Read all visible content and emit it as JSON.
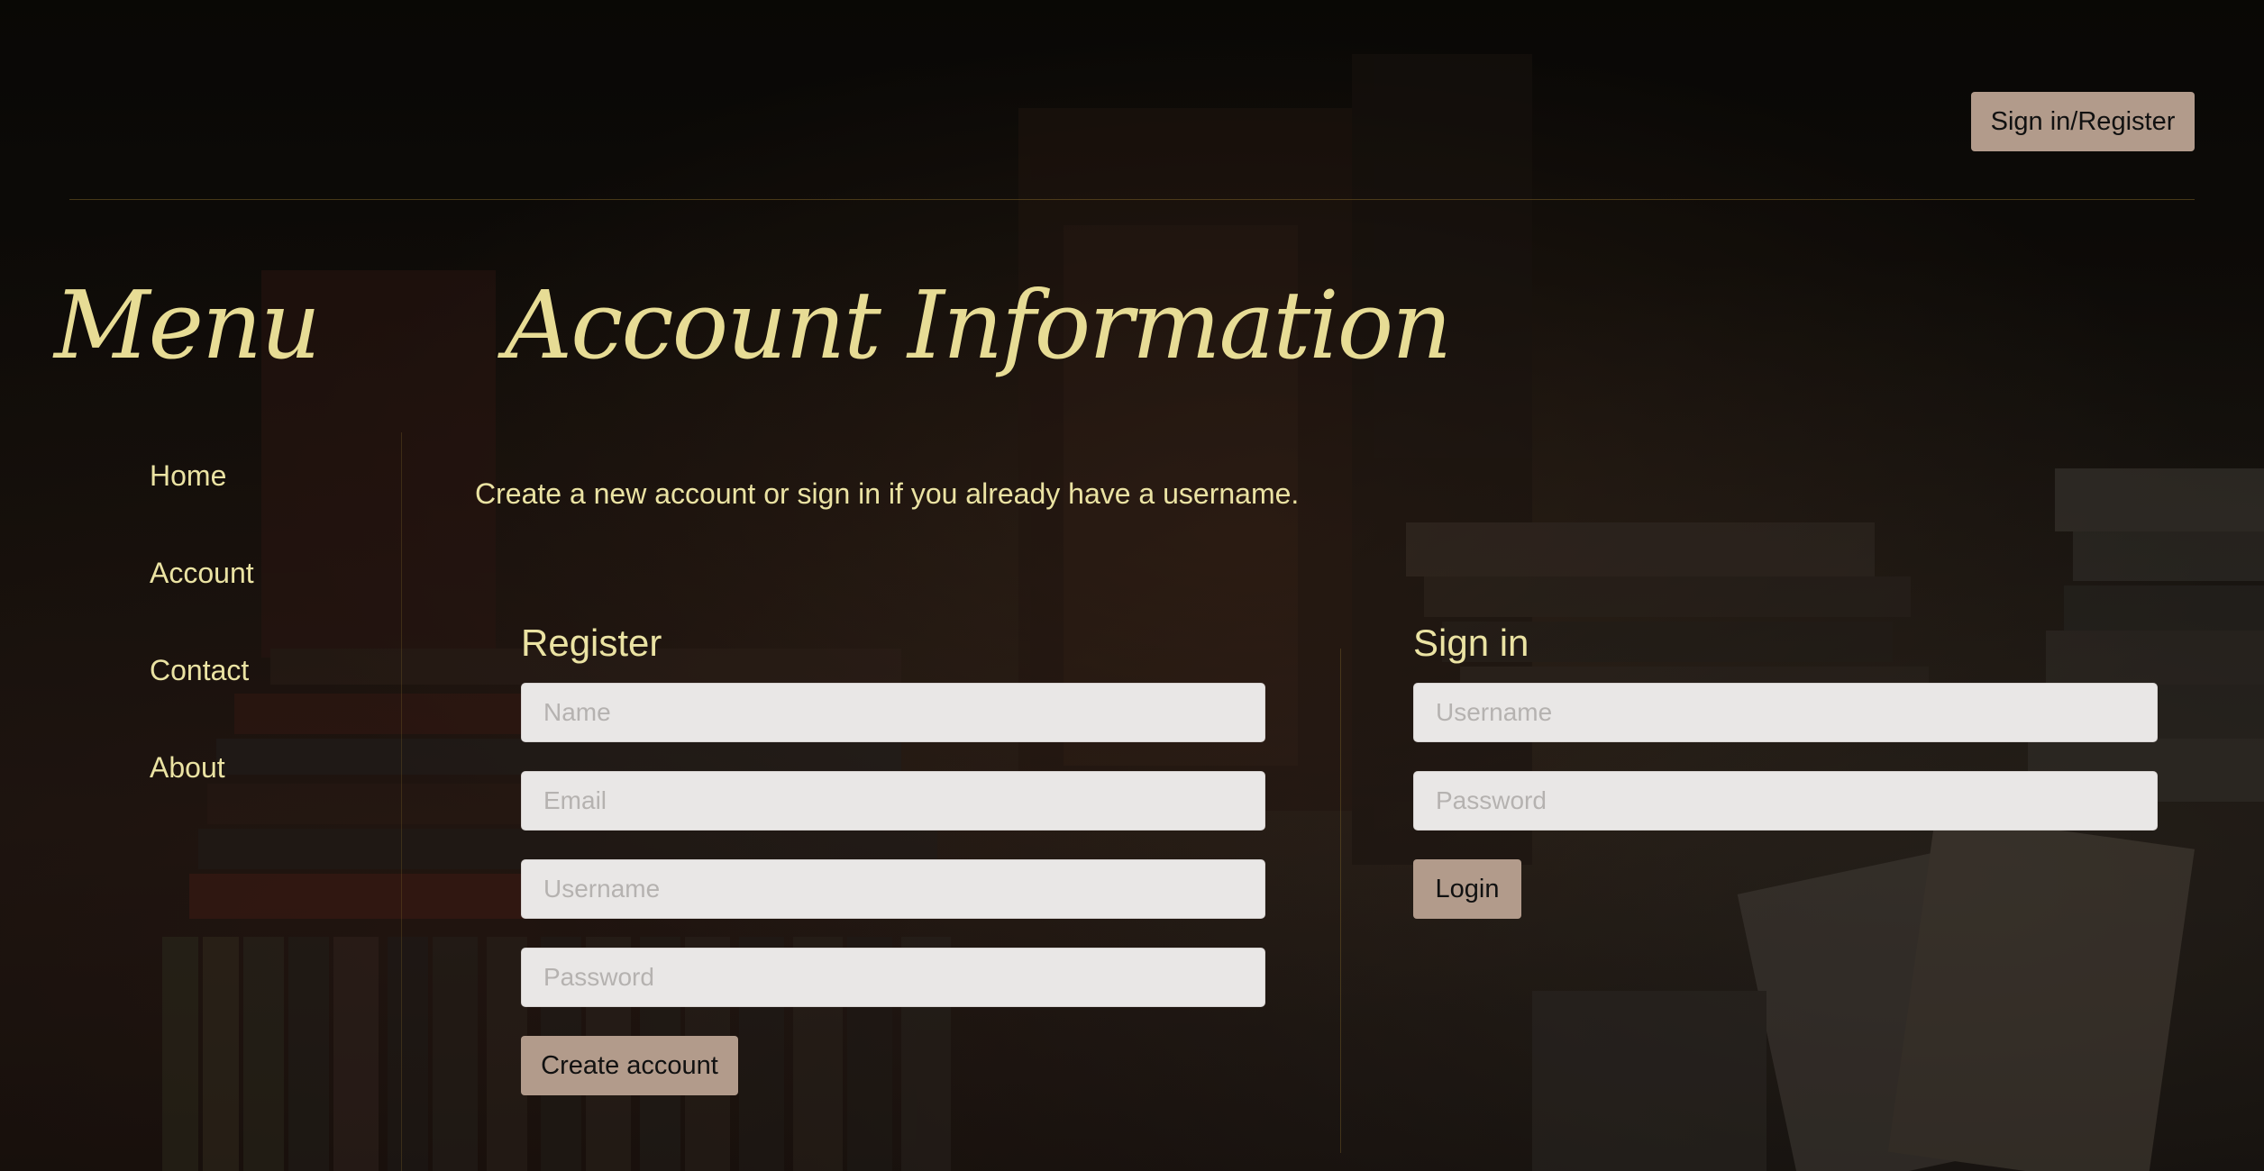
{
  "header": {
    "signin_register_label": "Sign in/Register"
  },
  "menu": {
    "title": "Menu",
    "items": [
      {
        "label": "Home"
      },
      {
        "label": "Account"
      },
      {
        "label": "Contact"
      },
      {
        "label": "About"
      }
    ]
  },
  "main": {
    "title": "Account Information",
    "intro": "Create a new account or sign in if you already have a username."
  },
  "register": {
    "title": "Register",
    "name_placeholder": "Name",
    "email_placeholder": "Email",
    "username_placeholder": "Username",
    "password_placeholder": "Password",
    "submit_label": "Create account"
  },
  "signin": {
    "title": "Sign in",
    "username_placeholder": "Username",
    "password_placeholder": "Password",
    "submit_label": "Login"
  },
  "colors": {
    "accent_text": "#ebe3a3",
    "button_bg": "#b29b8b",
    "input_bg": "#e9e7e6"
  }
}
